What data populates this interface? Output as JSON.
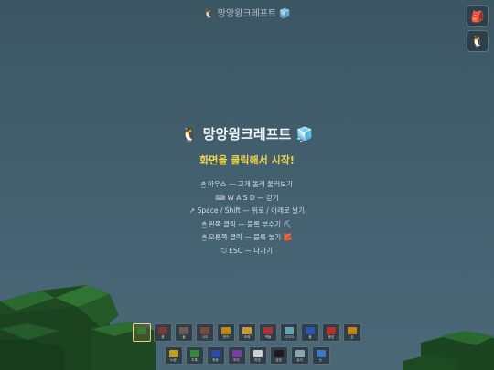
{
  "top_title": "🐧 망앙윙크레프트 🧊",
  "side_buttons": [
    {
      "label": "🎒",
      "name": "backpack-button"
    },
    {
      "label": "🐧",
      "name": "penguin-button"
    }
  ],
  "overlay": {
    "title": "🐧 망앙윙크레프트 🧊",
    "cta": "화면을 클릭해서 시작!",
    "controls": [
      "🖱 마우스 — 고개 돌려 둘러보기",
      "⌨ W A S D — 걷기",
      "↗ Space / Shift — 위로 / 아래로 날기",
      "🖱 왼쪽 클릭 — 블록 부수기 ⛏",
      "🖱 오른쪽 클릭 — 블록 놓기 🧱",
      "⎋ ESC — 나가기"
    ]
  },
  "hotbar_row1": [
    {
      "label": "",
      "color": "#3e7a33"
    },
    {
      "label": "흙",
      "color": "#7a3a35"
    },
    {
      "label": "돌",
      "color": "#6f5a5a"
    },
    {
      "label": "나무",
      "color": "#7a4a3a"
    },
    {
      "label": "판자",
      "color": "#c08a1a"
    },
    {
      "label": "모래",
      "color": "#c79a3a"
    },
    {
      "label": "벽돌",
      "color": "#a8343a"
    },
    {
      "label": "다이아",
      "color": "#6aa0b0"
    },
    {
      "label": "물",
      "color": "#2a56b0"
    },
    {
      "label": "용암",
      "color": "#b8302a"
    },
    {
      "label": "금",
      "color": "#c08a1a"
    }
  ],
  "hotbar_row2": [
    {
      "label": "노랑",
      "color": "#c0a020"
    },
    {
      "label": "초록",
      "color": "#3a8a3a"
    },
    {
      "label": "파랑",
      "color": "#2a4ab0"
    },
    {
      "label": "보라",
      "color": "#7a3aa8"
    },
    {
      "label": "하양",
      "color": "#d0d0d0"
    },
    {
      "label": "검정",
      "color": "#1a1a1a"
    },
    {
      "label": "유리",
      "color": "#8aa8b4"
    },
    {
      "label": "눈",
      "color": "#3a78c8"
    }
  ]
}
